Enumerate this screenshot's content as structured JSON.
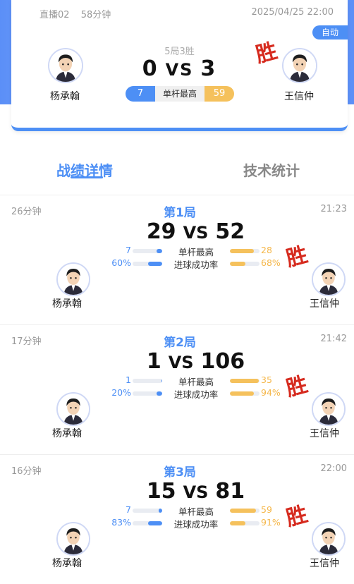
{
  "header": {
    "channel": "直播02",
    "duration": "58分钟",
    "datetime": "2025/04/25 22:00",
    "auto_badge": "自动",
    "rule": "5局3胜",
    "score_left": "0",
    "vs": "VS",
    "score_right": "3",
    "player_left": "杨承翰",
    "player_right": "王信仲",
    "win_stamp": "胜",
    "highest_break_label": "单杆最高",
    "highest_break_left": "7",
    "highest_break_right": "59"
  },
  "tabs": [
    {
      "label": "战绩详情",
      "active": true
    },
    {
      "label": "技术统计",
      "active": false
    }
  ],
  "games": [
    {
      "duration": "26分钟",
      "title": "第1局",
      "time": "21:23",
      "score_left": "29",
      "vs": "VS",
      "score_right": "52",
      "player_left": "杨承翰",
      "player_right": "王信仲",
      "winner_stamp": "胜",
      "stats": [
        {
          "label": "单杆最高",
          "left": "7",
          "right": "28",
          "left_fill": 0.2,
          "right_fill": 0.8
        },
        {
          "label": "进球成功率",
          "left": "60%",
          "right": "68%",
          "left_fill": 0.47,
          "right_fill": 0.53
        }
      ]
    },
    {
      "duration": "17分钟",
      "title": "第2局",
      "time": "21:42",
      "score_left": "1",
      "vs": "VS",
      "score_right": "106",
      "player_left": "杨承翰",
      "player_right": "王信仲",
      "winner_stamp": "胜",
      "stats": [
        {
          "label": "单杆最高",
          "left": "1",
          "right": "35",
          "left_fill": 0.03,
          "right_fill": 0.97
        },
        {
          "label": "进球成功率",
          "left": "20%",
          "right": "94%",
          "left_fill": 0.18,
          "right_fill": 0.82
        }
      ]
    },
    {
      "duration": "16分钟",
      "title": "第3局",
      "time": "22:00",
      "score_left": "15",
      "vs": "VS",
      "score_right": "81",
      "player_left": "杨承翰",
      "player_right": "王信仲",
      "winner_stamp": "胜",
      "stats": [
        {
          "label": "单杆最高",
          "left": "7",
          "right": "59",
          "left_fill": 0.11,
          "right_fill": 0.89
        },
        {
          "label": "进球成功率",
          "left": "83%",
          "right": "91%",
          "left_fill": 0.48,
          "right_fill": 0.52
        }
      ]
    }
  ],
  "colors": {
    "accent": "#4d8ff5",
    "gold": "#f5c15c",
    "win_red": "#d62b1f"
  }
}
